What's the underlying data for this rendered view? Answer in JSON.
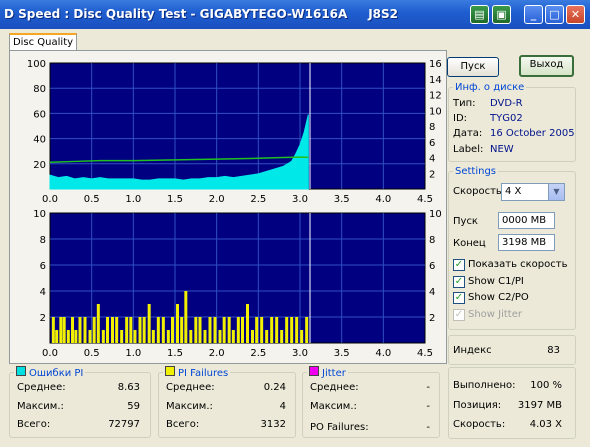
{
  "window": {
    "title": "D Speed : Disc Quality Test - GIGABYTEGO-W1616A     J8S2"
  },
  "tabs": [
    {
      "label": "Disc Quality"
    }
  ],
  "buttons": {
    "start": "Пуск",
    "exit": "Выход"
  },
  "disc_info": {
    "legend": "Инф. о диске",
    "rows": [
      {
        "label": "Тип:",
        "value": "DVD-R"
      },
      {
        "label": "ID:",
        "value": "TYG02"
      },
      {
        "label": "Дата:",
        "value": "16 October 2005"
      },
      {
        "label": "Label:",
        "value": "NEW"
      }
    ]
  },
  "settings": {
    "legend": "Settings",
    "speed_label": "Скорость",
    "speed_value": "4 X",
    "start_label": "Пуск",
    "start_value": "0000 MB",
    "end_label": "Конец",
    "end_value": "3198 MB",
    "checkboxes": [
      {
        "label": "Показать скорость",
        "checked": true,
        "enabled": true
      },
      {
        "label": "Show C1/PI",
        "checked": true,
        "enabled": true
      },
      {
        "label": "Show C2/PO",
        "checked": true,
        "enabled": true
      },
      {
        "label": "Show Jitter",
        "checked": true,
        "enabled": false
      }
    ]
  },
  "index": {
    "label": "Индекс",
    "value": "83"
  },
  "progress": {
    "rows": [
      {
        "label": "Выполнено:",
        "value": "100 %"
      },
      {
        "label": "Позиция:",
        "value": "3197 MB"
      },
      {
        "label": "Скорость:",
        "value": "4.03 X"
      }
    ]
  },
  "stats": {
    "pi_errors": {
      "legend": "Ошибки PI",
      "color": "#00e0e0",
      "rows": [
        {
          "label": "Среднее:",
          "value": "8.63"
        },
        {
          "label": "Максим.:",
          "value": "59"
        },
        {
          "label": "Всего:",
          "value": "72797"
        }
      ]
    },
    "pi_failures": {
      "legend": "PI Failures",
      "color": "#f0f000",
      "rows": [
        {
          "label": "Среднее:",
          "value": "0.24"
        },
        {
          "label": "Максим.:",
          "value": "4"
        },
        {
          "label": "Всего:",
          "value": "3132"
        }
      ]
    },
    "jitter": {
      "legend": "Jitter",
      "color": "#f000f0",
      "rows": [
        {
          "label": "Среднее:",
          "value": "-"
        },
        {
          "label": "Максим.:",
          "value": "-"
        }
      ],
      "po_label": "PO Failures:",
      "po_value": "-"
    }
  },
  "colors": {
    "plot_bg": "#000080",
    "grid": "#3050c0",
    "pi": "#00e8e8",
    "speed": "#20c020",
    "pif": "#f0f000",
    "marker": "#ffffff"
  },
  "chart_data": [
    {
      "type": "area",
      "x_ticks": [
        "0.0",
        "0.5",
        "1.0",
        "1.5",
        "2.0",
        "2.5",
        "3.0",
        "3.5",
        "4.0",
        "4.5"
      ],
      "y_ticks_left": [
        "20",
        "40",
        "60",
        "80",
        "100"
      ],
      "y_ticks_right": [
        "2",
        "4",
        "6",
        "8",
        "10",
        "12",
        "14",
        "16"
      ],
      "xlim": [
        0,
        4.5
      ],
      "ylim": [
        0,
        100
      ],
      "y2lim": [
        0,
        16
      ],
      "series": [
        {
          "x": [
            0.0,
            0.1,
            0.2,
            0.3,
            0.4,
            0.5,
            0.6,
            0.7,
            0.8,
            0.9,
            1.0,
            1.1,
            1.2,
            1.3,
            1.4,
            1.5,
            1.6,
            1.7,
            1.8,
            1.9,
            2.0,
            2.1,
            2.2,
            2.3,
            2.4,
            2.5,
            2.6,
            2.7,
            2.8,
            2.9,
            2.95,
            3.0,
            3.05,
            3.1
          ],
          "values": [
            11,
            9,
            10,
            8,
            9,
            8,
            9,
            8,
            8,
            8,
            8,
            7,
            7,
            8,
            8,
            8,
            7,
            8,
            8,
            9,
            9,
            10,
            9,
            10,
            11,
            12,
            14,
            16,
            18,
            22,
            28,
            35,
            45,
            59
          ]
        },
        {
          "x": [
            0.0,
            0.3,
            0.6,
            1.0,
            1.5,
            2.0,
            2.5,
            2.8,
            3.0,
            3.1
          ],
          "values": [
            3.4,
            3.5,
            3.6,
            3.6,
            3.7,
            3.8,
            3.9,
            4.0,
            4.05,
            4.03
          ]
        }
      ],
      "marker_x": 3.12
    },
    {
      "type": "bar",
      "x_ticks": [
        "0.0",
        "0.5",
        "1.0",
        "1.5",
        "2.0",
        "2.5",
        "3.0",
        "3.5",
        "4.0",
        "4.5"
      ],
      "y_ticks_left": [
        "2",
        "4",
        "6",
        "8",
        "10"
      ],
      "y_ticks_right": [
        "2",
        "4",
        "6",
        "8",
        "10"
      ],
      "xlim": [
        0,
        4.5
      ],
      "ylim": [
        0,
        10
      ],
      "series": [
        {
          "x": [
            0.04,
            0.08,
            0.13,
            0.17,
            0.22,
            0.27,
            0.31,
            0.36,
            0.42,
            0.48,
            0.53,
            0.58,
            0.64,
            0.69,
            0.75,
            0.8,
            0.86,
            0.92,
            0.97,
            1.02,
            1.08,
            1.13,
            1.19,
            1.24,
            1.3,
            1.36,
            1.42,
            1.47,
            1.53,
            1.58,
            1.63,
            1.69,
            1.75,
            1.8,
            1.86,
            1.92,
            1.98,
            2.04,
            2.09,
            2.15,
            2.2,
            2.26,
            2.31,
            2.37,
            2.43,
            2.48,
            2.54,
            2.6,
            2.66,
            2.72,
            2.78,
            2.84,
            2.9,
            2.96,
            3.02,
            3.08
          ],
          "values": [
            2,
            1,
            2,
            2,
            1,
            2,
            1,
            2,
            2,
            1,
            2,
            3,
            1,
            2,
            2,
            2,
            1,
            2,
            2,
            1,
            2,
            2,
            3,
            1,
            2,
            2,
            1,
            2,
            3,
            2,
            4,
            1,
            2,
            2,
            1,
            2,
            2,
            1,
            2,
            2,
            1,
            2,
            2,
            3,
            1,
            2,
            2,
            1,
            2,
            2,
            1,
            2,
            2,
            2,
            1,
            2
          ]
        }
      ],
      "marker_x": 3.12
    }
  ]
}
